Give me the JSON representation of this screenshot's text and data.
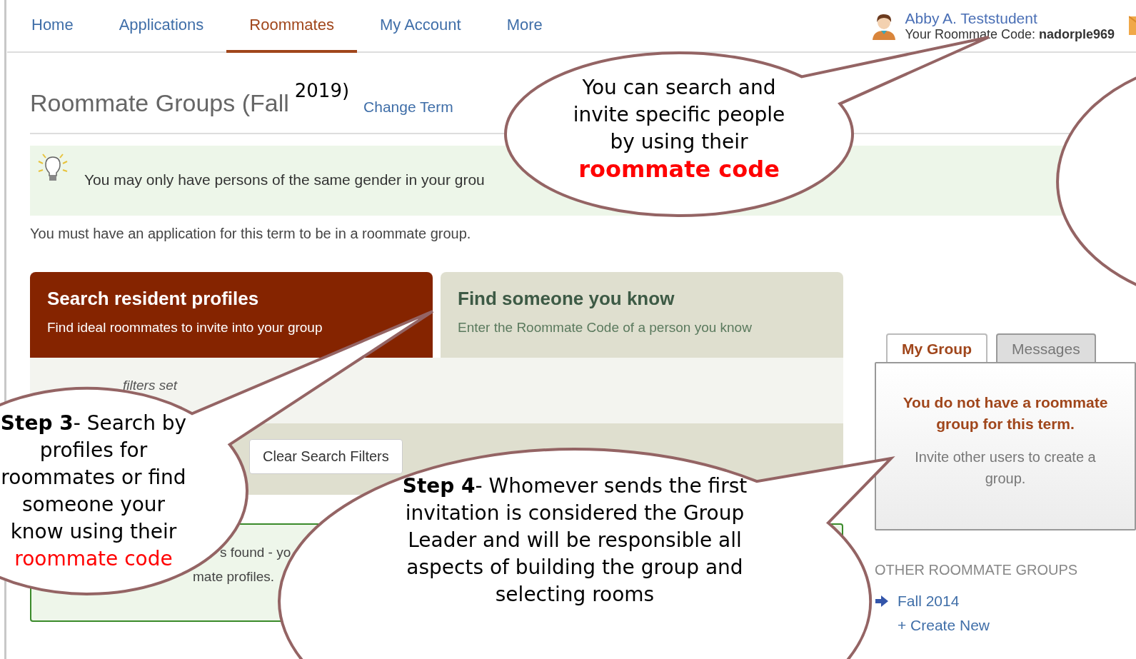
{
  "nav": {
    "tabs": [
      {
        "label": "Home",
        "selected": false
      },
      {
        "label": "Applications",
        "selected": false
      },
      {
        "label": "Roommates",
        "selected": true
      },
      {
        "label": "My Account",
        "selected": false
      },
      {
        "label": "More",
        "selected": false
      }
    ]
  },
  "user": {
    "name": "Abby A. Teststudent",
    "code_line": "Your Roommate Code: **nadorple969**"
  },
  "page": {
    "title": "Roommate Groups (Fall",
    "title_year": "2019)",
    "change_term": "Change Term"
  },
  "tip": "You may only have persons of the same gender in your grou",
  "note": "You must have an application for this term to be in a roommate group.",
  "cards": [
    {
      "title": "Search resident profiles",
      "subtitle": "Find ideal roommates to invite into your group",
      "selected": true
    },
    {
      "title": "Find someone you know",
      "subtitle": "Enter the Roommate Code of a person you know",
      "selected": false
    }
  ],
  "filters": {
    "status": "filters set",
    "clear_button": "Clear Search Filters"
  },
  "results": {
    "lines": [
      "s found - yo",
      "mate profiles."
    ]
  },
  "sidebar": {
    "tabs": [
      {
        "label": "My Group",
        "selected": true
      },
      {
        "label": "Messages",
        "selected": false
      }
    ],
    "notice_title": "You do not have a roommate group for this term.",
    "notice_body": "Invite other users to create a group.",
    "other_heading": "OTHER ROOMMATE GROUPS",
    "other_groups": [
      {
        "label": "Fall 2014"
      }
    ],
    "create_new": "+ Create New"
  },
  "callouts": [
    {
      "text": "You can search and invite specific people by using their",
      "highlight": "roommate code",
      "highlight_bold": true
    },
    {
      "text": "**Step 3**- Search by profiles for roommates or find someone your know using their",
      "highlight": "roommate code",
      "highlight_bold": false
    },
    {
      "text": "**Step 4**- Whomever sends the first invitation is considered the Group Leader and will be responsible all aspects of building the group and selecting rooms"
    }
  ]
}
